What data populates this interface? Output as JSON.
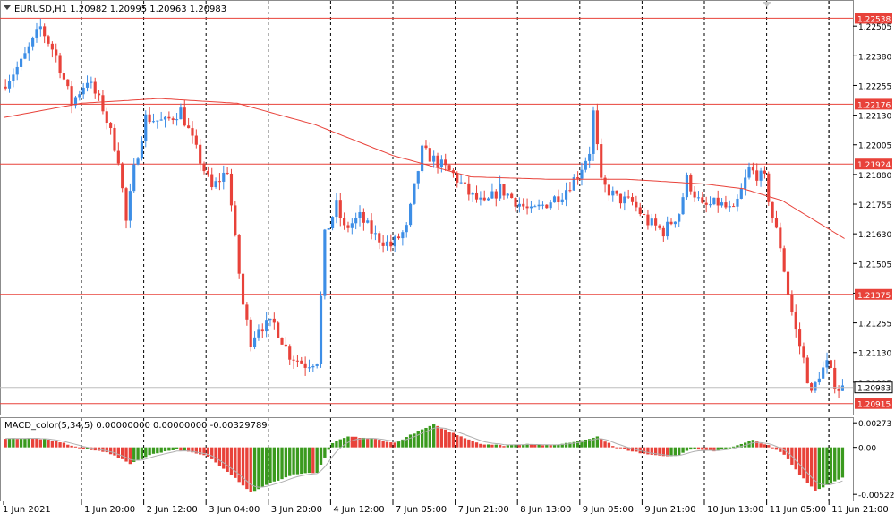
{
  "main": {
    "header_label": "EURUSD,H1  1.20982 1.20995 1.20963 1.20983",
    "price_axis": {
      "min": 1.2088,
      "max": 1.226,
      "ticks": [
        {
          "value": 1.22505,
          "label": "1.22505"
        },
        {
          "value": 1.2238,
          "label": "1.22380"
        },
        {
          "value": 1.22255,
          "label": "1.22255"
        },
        {
          "value": 1.2213,
          "label": "1.22130"
        },
        {
          "value": 1.22005,
          "label": "1.22005"
        },
        {
          "value": 1.2188,
          "label": "1.21880"
        },
        {
          "value": 1.21755,
          "label": "1.21755"
        },
        {
          "value": 1.2163,
          "label": "1.21630"
        },
        {
          "value": 1.21505,
          "label": "1.21505"
        },
        {
          "value": 1.2138,
          "label": "1.21380"
        },
        {
          "value": 1.21255,
          "label": "1.21255"
        },
        {
          "value": 1.2113,
          "label": "1.21130"
        },
        {
          "value": 1.21005,
          "label": "1.21005"
        }
      ]
    },
    "levels": [
      {
        "value": 1.22538,
        "label": "1.22538"
      },
      {
        "value": 1.22176,
        "label": "1.22176"
      },
      {
        "value": 1.21924,
        "label": "1.21924"
      },
      {
        "value": 1.21375,
        "label": "1.21375"
      },
      {
        "value": 1.20915,
        "label": "1.20915"
      }
    ],
    "current_price": {
      "value": 1.20983,
      "label": "1.20983"
    }
  },
  "time_axis": {
    "labels": [
      {
        "bar": 0,
        "text": "1 Jun 2021"
      },
      {
        "bar": 20,
        "text": "1 Jun 20:00"
      },
      {
        "bar": 36,
        "text": "2 Jun 12:00"
      },
      {
        "bar": 52,
        "text": "3 Jun 04:00"
      },
      {
        "bar": 68,
        "text": "3 Jun 20:00"
      },
      {
        "bar": 84,
        "text": "4 Jun 12:00"
      },
      {
        "bar": 100,
        "text": "7 Jun 05:00"
      },
      {
        "bar": 116,
        "text": "7 Jun 21:00"
      },
      {
        "bar": 132,
        "text": "8 Jun 13:00"
      },
      {
        "bar": 148,
        "text": "9 Jun 05:00"
      },
      {
        "bar": 164,
        "text": "9 Jun 21:00"
      },
      {
        "bar": 180,
        "text": "10 Jun 13:00"
      },
      {
        "bar": 196,
        "text": "11 Jun 05:00"
      },
      {
        "bar": 212,
        "text": "11 Jun 21:00"
      }
    ]
  },
  "macd": {
    "header_label": "MACD_color(5,34,5) 0.00000000 0.00000000 -0.00329789",
    "axis": {
      "min": -0.0056,
      "max": 0.00295,
      "ticks": [
        {
          "value": 0.00273,
          "label": "0.00273"
        },
        {
          "value": 0.0,
          "label": "0.00"
        },
        {
          "value": -0.00522,
          "label": "-0.00522"
        }
      ]
    }
  },
  "chart_data": {
    "type": "candlestick",
    "symbol": "EURUSD",
    "timeframe": "H1",
    "series": [
      {
        "name": "EURUSD",
        "close_path": [
          [
            0,
            1.2225
          ],
          [
            5,
            1.2235
          ],
          [
            10,
            1.225
          ],
          [
            14,
            1.2238
          ],
          [
            18,
            1.2218
          ],
          [
            22,
            1.2228
          ],
          [
            26,
            1.2216
          ],
          [
            30,
            1.2195
          ],
          [
            32,
            1.2168
          ],
          [
            34,
            1.219
          ],
          [
            37,
            1.2212
          ],
          [
            42,
            1.221
          ],
          [
            46,
            1.2215
          ],
          [
            50,
            1.2198
          ],
          [
            54,
            1.2182
          ],
          [
            58,
            1.219
          ],
          [
            60,
            1.216
          ],
          [
            62,
            1.2133
          ],
          [
            64,
            1.2118
          ],
          [
            66,
            1.2124
          ],
          [
            70,
            1.2125
          ],
          [
            74,
            1.2112
          ],
          [
            78,
            1.2108
          ],
          [
            81,
            1.211
          ],
          [
            83,
            1.2162
          ],
          [
            86,
            1.2175
          ],
          [
            88,
            1.2165
          ],
          [
            92,
            1.217
          ],
          [
            96,
            1.2162
          ],
          [
            100,
            1.2158
          ],
          [
            104,
            1.2165
          ],
          [
            106,
            1.2182
          ],
          [
            108,
            1.2198
          ],
          [
            112,
            1.2193
          ],
          [
            116,
            1.2188
          ],
          [
            120,
            1.218
          ],
          [
            124,
            1.2175
          ],
          [
            128,
            1.2182
          ],
          [
            132,
            1.2177
          ],
          [
            136,
            1.2172
          ],
          [
            140,
            1.2176
          ],
          [
            144,
            1.218
          ],
          [
            148,
            1.2188
          ],
          [
            151,
            1.2198
          ],
          [
            152,
            1.2214
          ],
          [
            154,
            1.2184
          ],
          [
            158,
            1.2178
          ],
          [
            162,
            1.2176
          ],
          [
            166,
            1.2168
          ],
          [
            170,
            1.2164
          ],
          [
            174,
            1.2172
          ],
          [
            176,
            1.2186
          ],
          [
            180,
            1.2174
          ],
          [
            184,
            1.2176
          ],
          [
            188,
            1.2172
          ],
          [
            192,
            1.219
          ],
          [
            196,
            1.2186
          ],
          [
            198,
            1.217
          ],
          [
            200,
            1.2158
          ],
          [
            202,
            1.2138
          ],
          [
            204,
            1.2122
          ],
          [
            206,
            1.211
          ],
          [
            208,
            1.2095
          ],
          [
            210,
            1.2104
          ],
          [
            212,
            1.2108
          ],
          [
            214,
            1.21
          ],
          [
            215,
            1.2098
          ]
        ],
        "moving_average_path": [
          [
            0,
            1.2212
          ],
          [
            20,
            1.2218
          ],
          [
            40,
            1.222
          ],
          [
            60,
            1.2218
          ],
          [
            80,
            1.2209
          ],
          [
            100,
            1.2196
          ],
          [
            120,
            1.2187
          ],
          [
            140,
            1.2186
          ],
          [
            160,
            1.2186
          ],
          [
            180,
            1.2184
          ],
          [
            190,
            1.2182
          ],
          [
            200,
            1.2177
          ],
          [
            210,
            1.2167
          ],
          [
            216,
            1.2161
          ]
        ]
      }
    ],
    "macd_path": [
      [
        0,
        0.001
      ],
      [
        8,
        0.001
      ],
      [
        14,
        0.0006
      ],
      [
        20,
        -0.0002
      ],
      [
        26,
        -0.0005
      ],
      [
        32,
        -0.0018
      ],
      [
        38,
        -0.0007
      ],
      [
        44,
        -0.0002
      ],
      [
        52,
        -0.001
      ],
      [
        58,
        -0.003
      ],
      [
        63,
        -0.005
      ],
      [
        68,
        -0.004
      ],
      [
        74,
        -0.003
      ],
      [
        80,
        -0.0028
      ],
      [
        84,
        0.0005
      ],
      [
        88,
        0.0012
      ],
      [
        94,
        0.001
      ],
      [
        100,
        0.0005
      ],
      [
        106,
        0.0018
      ],
      [
        110,
        0.0025
      ],
      [
        116,
        0.0014
      ],
      [
        122,
        0.0004
      ],
      [
        128,
        0.0002
      ],
      [
        134,
        0.0004
      ],
      [
        140,
        0.0002
      ],
      [
        146,
        0.0006
      ],
      [
        152,
        0.0012
      ],
      [
        156,
        0.0002
      ],
      [
        160,
        -0.0004
      ],
      [
        166,
        -0.0008
      ],
      [
        172,
        -0.001
      ],
      [
        176,
        -0.0002
      ],
      [
        182,
        -0.0004
      ],
      [
        188,
        0.0002
      ],
      [
        192,
        0.0008
      ],
      [
        196,
        0.0002
      ],
      [
        200,
        -0.0008
      ],
      [
        204,
        -0.003
      ],
      [
        208,
        -0.0048
      ],
      [
        212,
        -0.004
      ],
      [
        215,
        -0.0033
      ]
    ],
    "bar_count": 216,
    "grid": true,
    "colors": {
      "up": "#3d8ee6",
      "down": "#e8423a",
      "level": "#e8423a",
      "ma": "#e8423a",
      "macd_up": "#3a9a1e",
      "macd_down": "#e8423a"
    }
  }
}
